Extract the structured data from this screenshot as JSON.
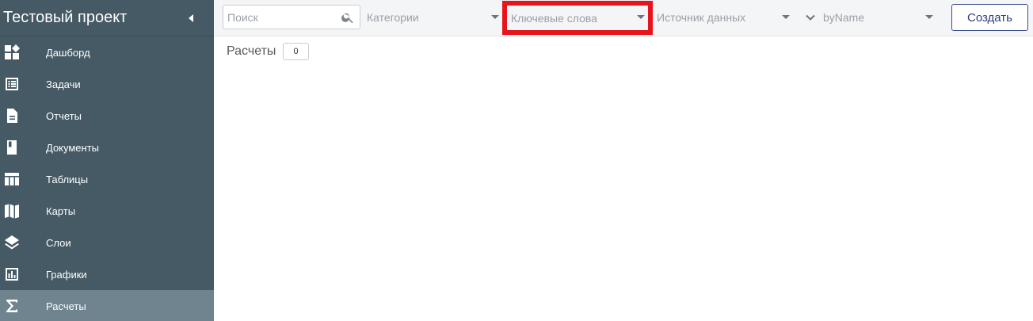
{
  "sidebar": {
    "title": "Тестовый проект",
    "items": [
      {
        "label": "Дашборд",
        "icon": "dashboard-icon"
      },
      {
        "label": "Задачи",
        "icon": "tasks-icon"
      },
      {
        "label": "Отчеты",
        "icon": "reports-icon"
      },
      {
        "label": "Документы",
        "icon": "documents-icon"
      },
      {
        "label": "Таблицы",
        "icon": "tables-icon"
      },
      {
        "label": "Карты",
        "icon": "maps-icon"
      },
      {
        "label": "Слои",
        "icon": "layers-icon"
      },
      {
        "label": "Графики",
        "icon": "charts-icon"
      },
      {
        "label": "Расчеты",
        "icon": "sigma-icon",
        "active": true
      }
    ]
  },
  "toolbar": {
    "search_placeholder": "Поиск",
    "categories_label": "Категории",
    "keywords_label": "Ключевые слова",
    "source_label": "Источник данных",
    "sort_label": "byName",
    "create_label": "Создать"
  },
  "content": {
    "title": "Расчеты",
    "count": "0"
  },
  "colors": {
    "sidebar_bg": "#455a64",
    "active_item_bg": "#6f848e",
    "highlight": "#e8141b",
    "button_accent": "#2f3e79"
  }
}
